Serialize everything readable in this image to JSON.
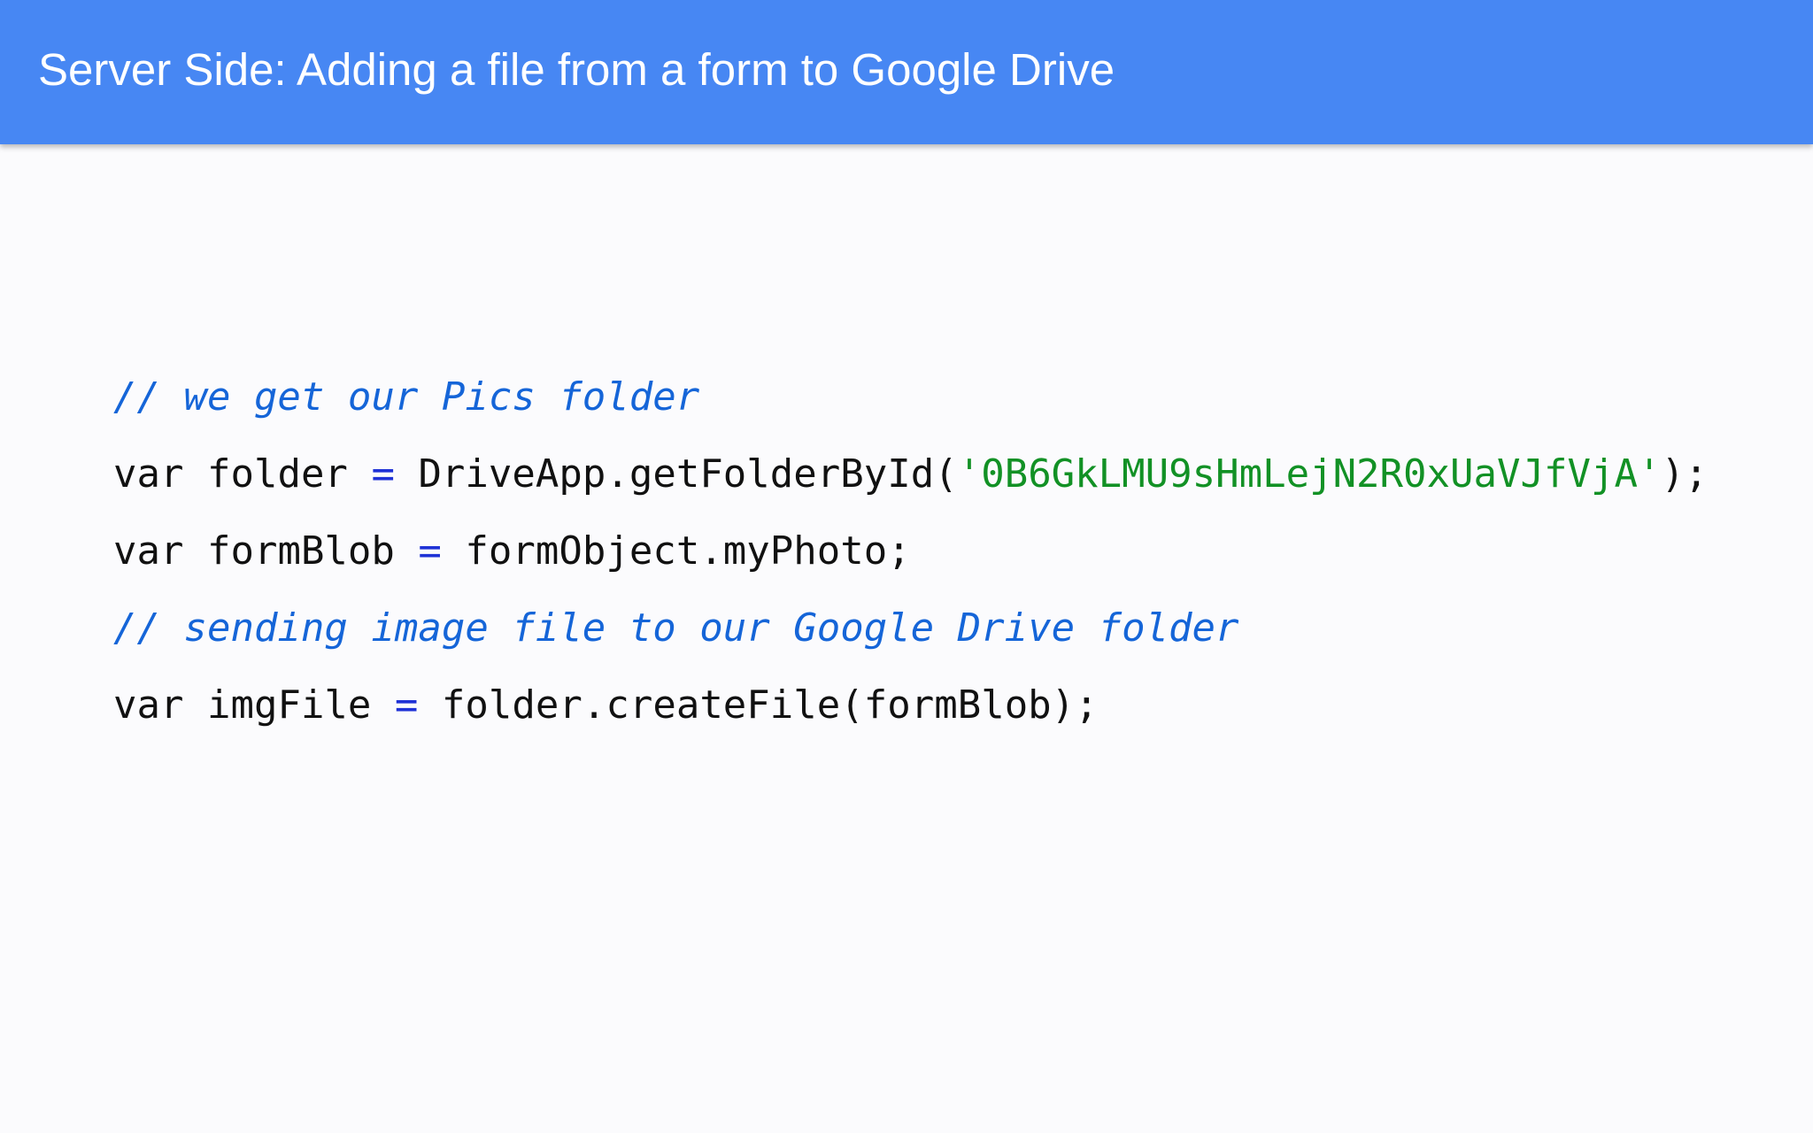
{
  "slide": {
    "title": "Server Side: Adding a file from a form to Google Drive"
  },
  "code": {
    "line1": {
      "comment": "// we get our Pics folder"
    },
    "line2": {
      "kw": "var",
      "name": "folder",
      "op": "=",
      "call_start": "DriveApp.getFolderById(",
      "str": "'0B6GkLMU9sHmLejN2R0xUaVJfVjA'",
      "call_end": ");"
    },
    "line3": {
      "kw": "var",
      "name": "formBlob",
      "op": "=",
      "rest": "formObject.myPhoto;"
    },
    "line4": {
      "comment": "// sending image file to our Google Drive folder"
    },
    "line5": {
      "kw": "var",
      "name": "imgFile",
      "op": "=",
      "rest": "folder.createFile(formBlob);"
    }
  },
  "colors": {
    "header": "#4787f3",
    "background": "#fbfbfd",
    "comment": "#1565d8",
    "operator": "#1f32d6",
    "string": "#129125",
    "text": "#111111"
  }
}
